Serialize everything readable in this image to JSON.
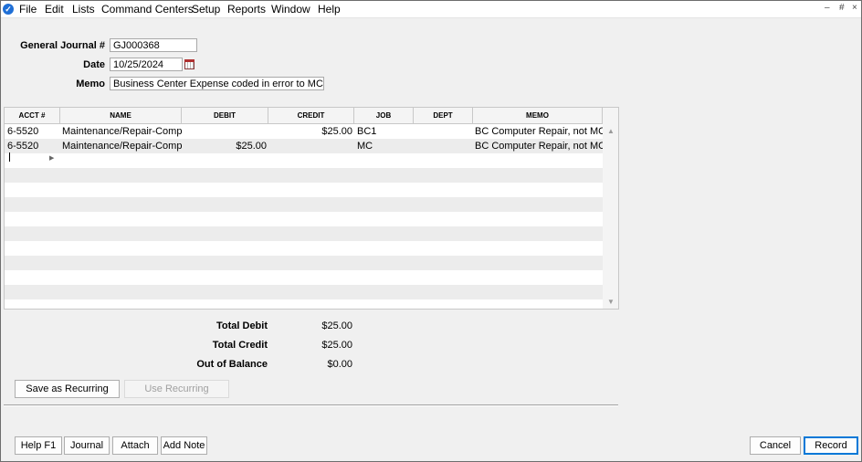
{
  "menu": {
    "items": [
      "File",
      "Edit",
      "Lists",
      "Command Centers",
      "Setup",
      "Reports",
      "Window",
      "Help"
    ],
    "window_controls": [
      "–",
      "#",
      "×"
    ]
  },
  "header": {
    "journal_label": "General Journal #",
    "journal_value": "GJ000368",
    "date_label": "Date",
    "date_value": "10/25/2024",
    "memo_label": "Memo",
    "memo_value": "Business Center Expense coded in error to MC"
  },
  "grid": {
    "columns": [
      "ACCT #",
      "NAME",
      "DEBIT",
      "CREDIT",
      "JOB",
      "DEPT",
      "MEMO"
    ],
    "rows": [
      {
        "acct": "6-5520",
        "name": "Maintenance/Repair-Compu",
        "debit": "",
        "credit": "$25.00",
        "job": "BC1",
        "dept": "",
        "memo": "BC Computer Repair, not MC"
      },
      {
        "acct": "6-5520",
        "name": "Maintenance/Repair-Compu",
        "debit": "$25.00",
        "credit": "",
        "job": "MC",
        "dept": "",
        "memo": "BC Computer Repair, not MC"
      }
    ]
  },
  "totals": {
    "debit_label": "Total Debit",
    "debit_value": "$25.00",
    "credit_label": "Total Credit",
    "credit_value": "$25.00",
    "balance_label": "Out of Balance",
    "balance_value": "$0.00"
  },
  "buttons": {
    "save_recurring": "Save as Recurring",
    "use_recurring": "Use Recurring",
    "help": "Help F1",
    "journal": "Journal",
    "attach": "Attach",
    "add_note": "Add Note",
    "cancel": "Cancel",
    "record": "Record"
  },
  "colors": {
    "accent": "#0078d7",
    "app_icon": "#1f6fd6"
  }
}
